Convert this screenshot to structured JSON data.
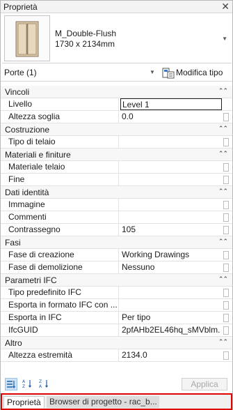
{
  "panel": {
    "title": "Proprietà",
    "close_glyph": "✕"
  },
  "type_selector": {
    "name": "M_Double-Flush",
    "size": "1730 x 2134mm",
    "dropdown_glyph": "▼"
  },
  "selection": {
    "label": "Porte (1)",
    "dropdown_glyph": "▼",
    "edit_type_label": "Modifica tipo"
  },
  "groups": [
    {
      "label": "Vincoli",
      "collapse_glyph": "⌃⌃",
      "rows": [
        {
          "name": "Livello",
          "value": "Level 1",
          "editing": true
        },
        {
          "name": "Altezza soglia",
          "value": "0.0"
        }
      ]
    },
    {
      "label": "Costruzione",
      "collapse_glyph": "⌃⌃",
      "rows": [
        {
          "name": "Tipo di telaio",
          "value": ""
        }
      ]
    },
    {
      "label": "Materiali e finiture",
      "collapse_glyph": "⌃⌃",
      "rows": [
        {
          "name": "Materiale telaio",
          "value": ""
        },
        {
          "name": "Fine",
          "value": ""
        }
      ]
    },
    {
      "label": "Dati identità",
      "collapse_glyph": "⌃⌃",
      "rows": [
        {
          "name": "Immagine",
          "value": ""
        },
        {
          "name": "Commenti",
          "value": ""
        },
        {
          "name": "Contrassegno",
          "value": "105"
        }
      ]
    },
    {
      "label": "Fasi",
      "collapse_glyph": "⌃⌃",
      "rows": [
        {
          "name": "Fase di creazione",
          "value": "Working Drawings"
        },
        {
          "name": "Fase di demolizione",
          "value": "Nessuno"
        }
      ]
    },
    {
      "label": "Parametri IFC",
      "collapse_glyph": "⌃⌃",
      "rows": [
        {
          "name": "Tipo predefinito IFC",
          "value": ""
        },
        {
          "name": "Esporta in formato IFC con ...",
          "value": ""
        },
        {
          "name": "Esporta in IFC",
          "value": "Per tipo"
        },
        {
          "name": "IfcGUID",
          "value": "2pfAHb2EL46hq_sMVblm..."
        }
      ]
    },
    {
      "label": "Altro",
      "collapse_glyph": "⌃⌃",
      "rows": [
        {
          "name": "Altezza estremità",
          "value": "2134.0"
        }
      ]
    }
  ],
  "footer": {
    "apply_label": "Applica"
  },
  "tabs": [
    {
      "label": "Proprietà"
    },
    {
      "label": "Browser di progetto - rac_b..."
    }
  ],
  "colors": {
    "tab_highlight": "#e00000",
    "active_sort": "#cde3f5"
  }
}
